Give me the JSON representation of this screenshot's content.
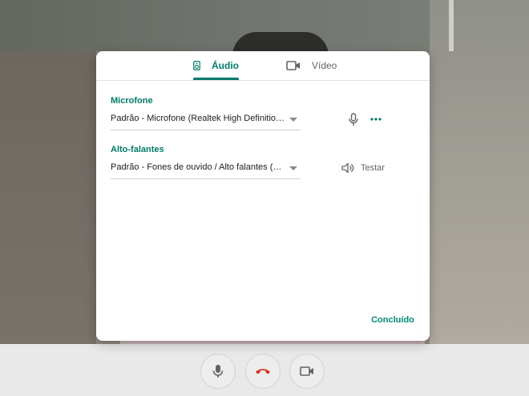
{
  "dialog": {
    "tabs": [
      {
        "label": "Áudio",
        "icon": "speaker-device-icon",
        "active": true
      },
      {
        "label": "Vídeo",
        "icon": "videocam-icon",
        "active": false
      }
    ],
    "microphone": {
      "label": "Microfone",
      "selected": "Padrão - Microfone (Realtek High Definition Audio)"
    },
    "speakers": {
      "label": "Alto-falantes",
      "selected": "Padrão - Fones de ouvido / Alto falantes (Realtek High Definition Audio)",
      "test_label": "Testar"
    },
    "done_label": "Concluído"
  },
  "call_controls": [
    {
      "name": "microphone",
      "icon": "mic-icon"
    },
    {
      "name": "hang-up",
      "icon": "hang-up-icon",
      "color": "#d93025"
    },
    {
      "name": "camera",
      "icon": "videocam-icon"
    }
  ],
  "colors": {
    "accent": "#00796b",
    "hangup": "#d93025"
  }
}
